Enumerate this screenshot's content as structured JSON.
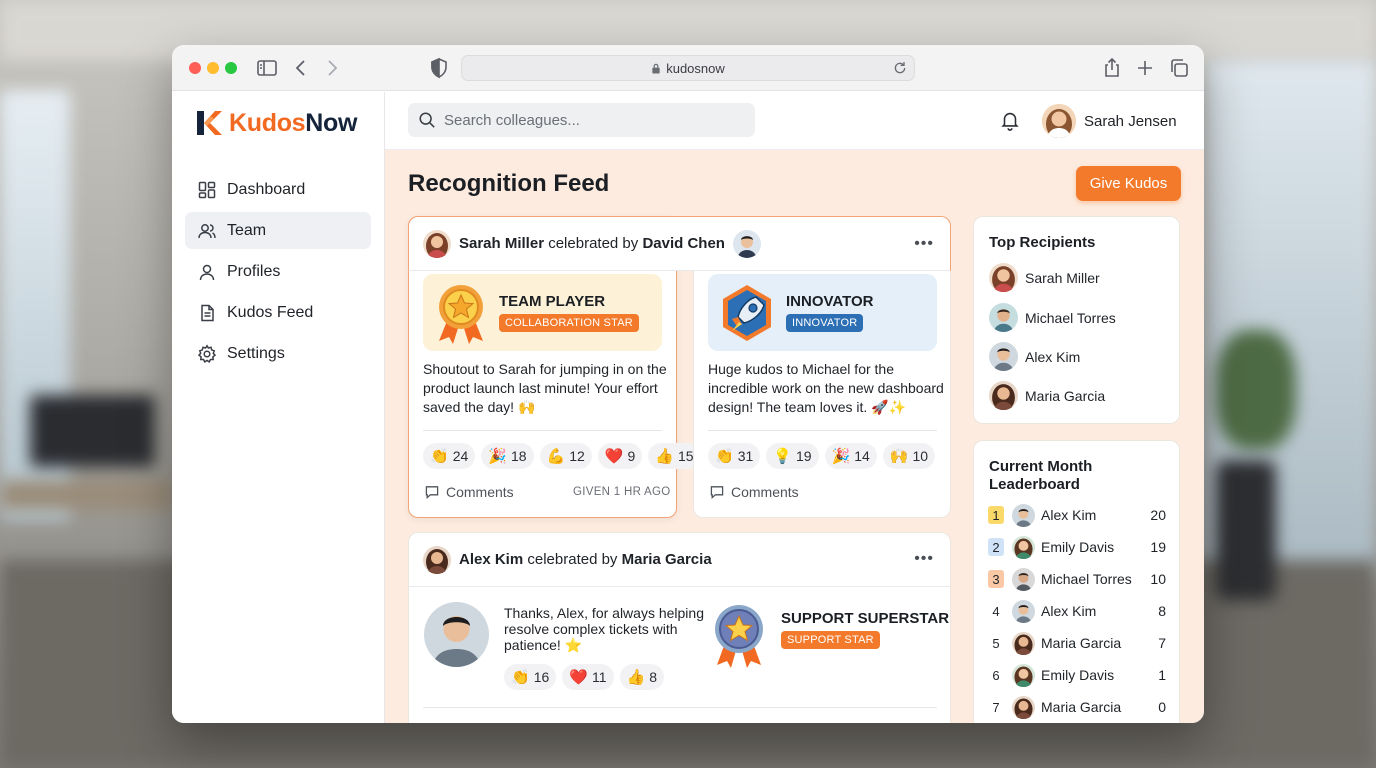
{
  "browser": {
    "url": "kudosnow"
  },
  "brand": {
    "name_a": "Kudos",
    "name_b": "Now"
  },
  "sidebar": {
    "items": [
      {
        "label": "Dashboard",
        "icon": "grid-icon"
      },
      {
        "label": "Team",
        "icon": "users-icon",
        "active": true
      },
      {
        "label": "Profiles",
        "icon": "user-icon"
      },
      {
        "label": "Kudos Feed",
        "icon": "document-icon"
      },
      {
        "label": "Settings",
        "icon": "gear-icon"
      }
    ]
  },
  "topbar": {
    "search_placeholder": "Search colleagues...",
    "user_name": "Sarah Jensen"
  },
  "feed": {
    "title": "Recognition Feed",
    "give_button": "Give Kudos"
  },
  "card1": {
    "recipient": "Sarah Miller",
    "connector": " celebrated by ",
    "giver": "David Chen",
    "badge_title": "TEAM PLAYER",
    "badge_pill": "COLLABORATION STAR",
    "message": "Shoutout to Sarah for jumping in on the product launch last minute! Your effort saved the day! 🙌",
    "reactions": [
      {
        "emoji": "👏",
        "count": "24"
      },
      {
        "emoji": "🎉",
        "count": "18"
      },
      {
        "emoji": "💪",
        "count": "12"
      },
      {
        "emoji": "❤️",
        "count": "9"
      },
      {
        "emoji": "👍",
        "count": "15"
      }
    ],
    "comments_label": "Comments",
    "given": "GIVEN 1 HR AGO"
  },
  "card2": {
    "badge_title": "INNOVATOR",
    "badge_pill": "INNOVATOR",
    "message": "Huge kudos to Michael for the incredible work on the new dashboard design! The team loves it. 🚀✨",
    "reactions": [
      {
        "emoji": "👏",
        "count": "31"
      },
      {
        "emoji": "💡",
        "count": "19"
      },
      {
        "emoji": "🎉",
        "count": "14"
      },
      {
        "emoji": "🙌",
        "count": "10"
      }
    ],
    "comments_label": "Comments"
  },
  "card3": {
    "recipient": "Alex Kim",
    "connector": " celebrated by ",
    "giver": "Maria Garcia",
    "message": "Thanks, Alex, for always helping resolve complex tickets with patience! ⭐",
    "reactions": [
      {
        "emoji": "👏",
        "count": "16"
      },
      {
        "emoji": "❤️",
        "count": "11"
      },
      {
        "emoji": "👍",
        "count": "8"
      }
    ],
    "badge_title": "SUPPORT SUPERSTAR",
    "badge_pill": "SUPPORT STAR"
  },
  "top_recipients": {
    "title": "Top Recipients",
    "items": [
      "Sarah Miller",
      "Michael Torres",
      "Alex Kim",
      "Maria Garcia"
    ]
  },
  "leaderboard": {
    "title_line1": "Current Month",
    "title_line2": "Leaderboard",
    "rows": [
      {
        "rank": "1",
        "name": "Alex Kim",
        "score": "20"
      },
      {
        "rank": "2",
        "name": "Emily Davis",
        "score": "19"
      },
      {
        "rank": "3",
        "name": "Michael Torres",
        "score": "10"
      },
      {
        "rank": "4",
        "name": "Alex Kim",
        "score": "8"
      },
      {
        "rank": "5",
        "name": "Maria Garcia",
        "score": "7"
      },
      {
        "rank": "6",
        "name": "Emily Davis",
        "score": "1"
      },
      {
        "rank": "7",
        "name": "Maria Garcia",
        "score": "0"
      }
    ]
  },
  "colors": {
    "accent": "#f47a2b",
    "navy": "#15243a",
    "feed_bg": "#fdebdf"
  }
}
